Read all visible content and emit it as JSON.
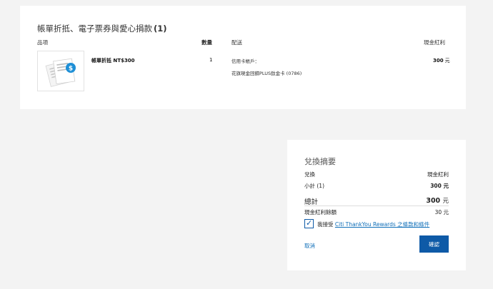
{
  "order": {
    "section_title": "帳單折抵、電子票券與愛心捐款",
    "section_count": "(1)",
    "columns": {
      "items": "品項",
      "qty": "數量",
      "shipping": "配送",
      "reward": "現金紅利"
    },
    "item": {
      "thumbnail_icon": "dollar-coin-document-icon",
      "name": "帳單折抵 NT$300",
      "qty": "1",
      "card_label": "信用卡帳戶：",
      "card_value": "花旗現金回饋PLUS鈦金卡 (0786)",
      "reward_value": "300",
      "reward_unit": "元"
    }
  },
  "summary": {
    "title": "兌換摘要",
    "header_left": "兌換",
    "header_right": "現金紅利",
    "subtotal_label": "小計 (1)",
    "subtotal_value": "300 元",
    "total_label": "總計",
    "total_value": "300",
    "total_unit": "元",
    "balance_label": "現金紅利餘額",
    "balance_value": "30 元",
    "agree_prefix": "我接受",
    "agree_link": "Citi ThankYou Rewards 之條款和條件",
    "agree_checked": true,
    "cancel_label": "取消",
    "confirm_label": "確認"
  },
  "colors": {
    "accent": "#0e5aa7",
    "link": "#0e6eb8",
    "background": "#f3f3f3",
    "coin": "#1e8fd6"
  }
}
